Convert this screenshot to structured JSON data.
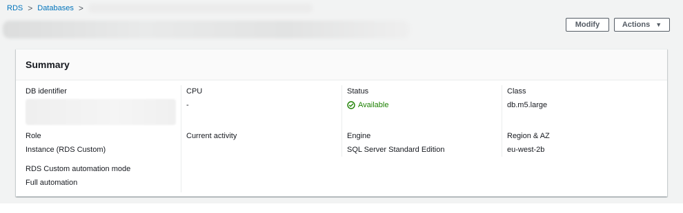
{
  "breadcrumb": {
    "items": [
      "RDS",
      "Databases"
    ],
    "separator": ">"
  },
  "toolbar": {
    "modify_label": "Modify",
    "actions_label": "Actions",
    "actions_caret": "▼"
  },
  "summary": {
    "title": "Summary",
    "fields": {
      "db_identifier": {
        "label": "DB identifier",
        "value": ""
      },
      "cpu": {
        "label": "CPU",
        "value": "-"
      },
      "status": {
        "label": "Status",
        "value": "Available"
      },
      "class": {
        "label": "Class",
        "value": "db.m5.large"
      },
      "role": {
        "label": "Role",
        "value": "Instance (RDS Custom)"
      },
      "current_activity": {
        "label": "Current activity",
        "value": ""
      },
      "engine": {
        "label": "Engine",
        "value": "SQL Server Standard Edition"
      },
      "region_az": {
        "label": "Region & AZ",
        "value": "eu-west-2b"
      },
      "automation_mode": {
        "label": "RDS Custom automation mode",
        "value": "Full automation"
      }
    }
  },
  "colors": {
    "link": "#0073bb",
    "status_available": "#1d8102",
    "button_border": "#545b64"
  },
  "icons": {
    "status": "check-circle-icon",
    "actions_caret": "caret-down-icon"
  }
}
